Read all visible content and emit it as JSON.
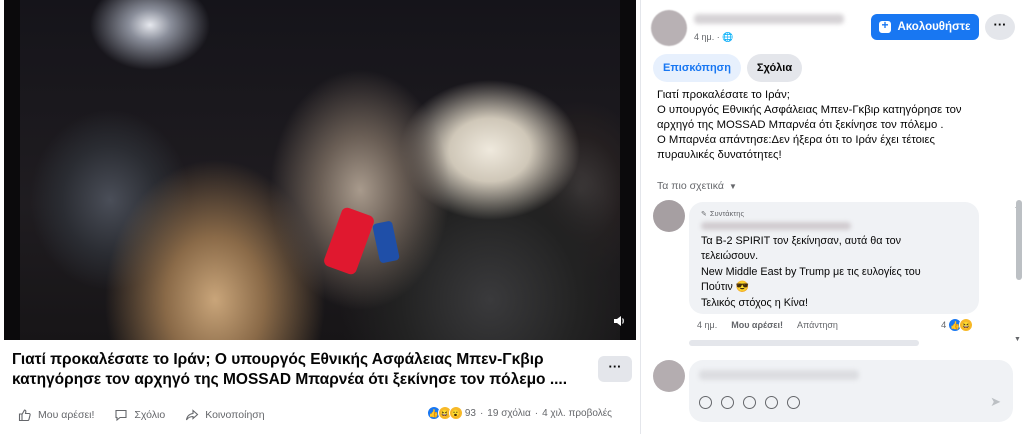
{
  "post": {
    "title_line1": "Γιατί προκαλέσατε το Ιράν; Ο υπουργός Εθνικής Ασφάλειας Μπεν-Γκβιρ",
    "title_line2": "κατηγόρησε τον αρχηγό της MOSSAD Μπαρνέα ότι ξεκίνησε τον πόλεμο ....",
    "more_label": "···"
  },
  "actions": {
    "like": "Μου αρέσει!",
    "comment": "Σχόλιο",
    "share": "Κοινοποίηση"
  },
  "stats": {
    "reactions_count": "93",
    "comments": "19 σχόλια",
    "views": "4 χιλ. προβολές",
    "separator": "·"
  },
  "sidebar": {
    "time": "4 ημ. · ",
    "follow_label": "Ακολουθήστε",
    "more_label": "···",
    "tabs": [
      {
        "label": "Επισκόπηση",
        "active": true
      },
      {
        "label": "Σχόλια",
        "active": false
      }
    ],
    "description": [
      "Γιατί προκαλέσατε το Ιράν;",
      "Ο υπουργός Εθνικής Ασφάλειας Μπεν-Γκβιρ κατηγόρησε τον",
      "αρχηγό της MOSSAD Μπαρνέα ότι ξεκίνησε τον πόλεμο .",
      "Ο Μπαρνέα απάντησε:Δεν ήξερα ότι το Ιράν έχει τέτοιες",
      "πυραυλικές δυνατότητες!"
    ],
    "sort_label": "Τα πιο σχετικά"
  },
  "comment": {
    "author_tag": "Συντάκτης",
    "lines": [
      "Τα B-2 SPIRIT τον ξεκίνησαν, αυτά θα τον",
      "τελειώσουν.",
      "New Middle East by Trump με τις ευλογίες του",
      "Πούτιν 😎",
      "Τελικός στόχος η Κίνα!"
    ],
    "time": "4 ημ.",
    "like": "Μου αρέσει!",
    "reply": "Απάντηση",
    "reaction_count": "4"
  },
  "colors": {
    "accent": "#1877f2",
    "muted": "#65676b",
    "bubble": "#f0f2f5"
  }
}
